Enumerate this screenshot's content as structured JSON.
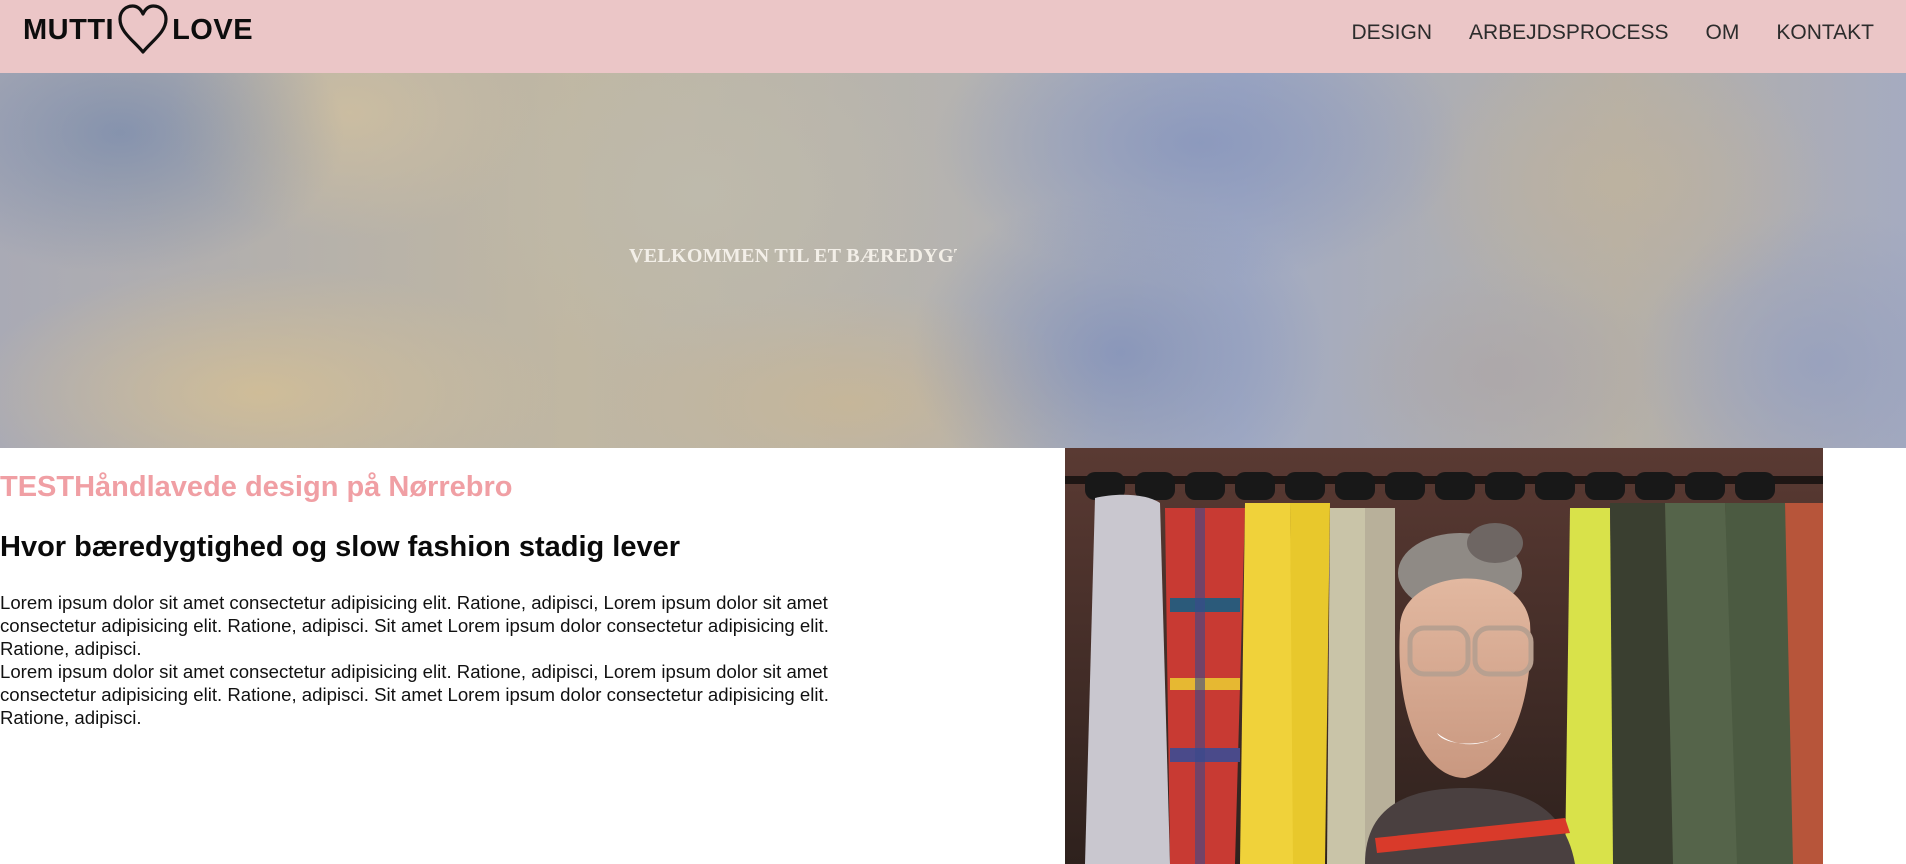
{
  "header": {
    "logo": {
      "word_left": "MUTTI",
      "word_right": "LOVE",
      "icon": "heart-outline-icon"
    },
    "nav": [
      {
        "label": "DESIGN"
      },
      {
        "label": "ARBEJDSPROCESS"
      },
      {
        "label": "OM"
      },
      {
        "label": "KONTAKT"
      }
    ],
    "background_color": "#ebc6c7"
  },
  "hero": {
    "text": "VELKOMMEN TIL ET BÆREDYGTIGT"
  },
  "main": {
    "title": "TESTHåndlavede design på Nørrebro",
    "subtitle": "Hvor bæredygtighed og slow fashion stadig lever",
    "paragraphs": [
      "Lorem ipsum dolor sit amet consectetur adipisicing elit. Ratione, adipisci, Lorem ipsum dolor sit amet consectetur adipisicing elit. Ratione, adipisci. Sit amet Lorem ipsum dolor consectetur adipisicing elit. Ratione, adipisci.",
      "Lorem ipsum dolor sit amet consectetur adipisicing elit. Ratione, adipisci, Lorem ipsum dolor sit amet consectetur adipisicing elit. Ratione, adipisci. Sit amet Lorem ipsum dolor consectetur adipisicing elit. Ratione, adipisci."
    ],
    "accent_color": "#f09fa4"
  }
}
